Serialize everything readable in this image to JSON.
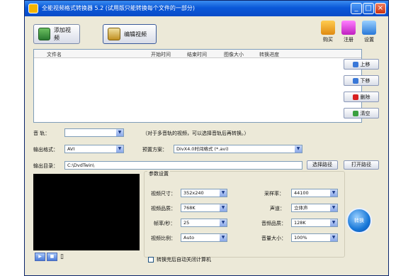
{
  "window": {
    "title": "全能视频格式转换器 5.2 (试用版只能转换每个文件的一部分)",
    "min": "_",
    "max": "□",
    "close": "×"
  },
  "toolbar": {
    "add_video": "添加视频",
    "edit_video": "编辑视频",
    "buy": "购买",
    "register": "注册",
    "settings": "设置"
  },
  "filelist": {
    "columns": [
      "文件名",
      "开始时间",
      "结束时间",
      "图像大小",
      "转换进度"
    ]
  },
  "side_buttons": {
    "up": "上移",
    "down": "下移",
    "delete": "删除",
    "clear": "清空"
  },
  "audio": {
    "label": "音    轨：",
    "value": "",
    "hint": "（对于多音轨的视频，可以选择音轨后再转换。）"
  },
  "output_format": {
    "label": "输出格式：",
    "value": "AVI"
  },
  "preset": {
    "label": "预置方案：",
    "value": "DivX4.0时间格式 (*.avi)"
  },
  "output_dir": {
    "label": "输出目录：",
    "value": "C:\\DvdTwin\\",
    "choose": "选择路径",
    "open": "打开路径"
  },
  "params": {
    "title": "参数设置",
    "video_size_label": "视频尺寸：",
    "video_size": "352x240",
    "video_quality_label": "视频品质：",
    "video_quality": "768K",
    "fps_label": "帧率/秒：",
    "fps": "25",
    "aspect_label": "视频比例：",
    "aspect": "Auto",
    "sample_rate_label": "采样率：",
    "sample_rate": "44100",
    "channel_label": "声道：",
    "channel": "立体声",
    "audio_quality_label": "音频品质：",
    "audio_quality": "128K",
    "volume_label": "音量大小：",
    "volume": "100%"
  },
  "convert": "转换",
  "shutdown": "转换完后自动关闭计算机"
}
